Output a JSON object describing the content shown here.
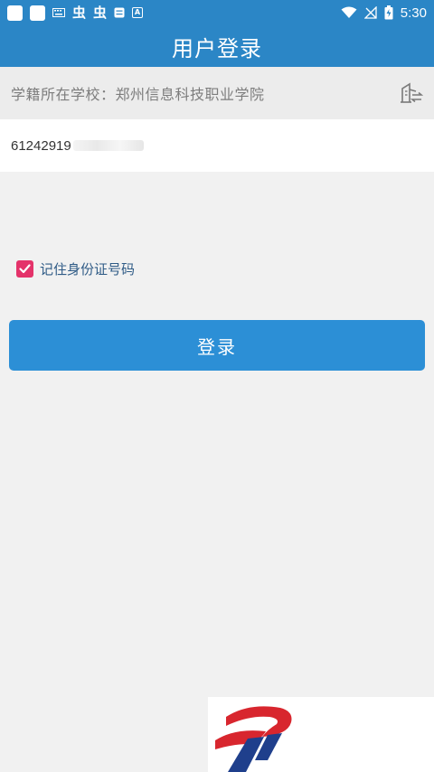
{
  "status_bar": {
    "time": "5:30",
    "left_glyph_1": "虫",
    "left_glyph_2": "虫",
    "left_box_label": "A",
    "icons": [
      "square-icon",
      "square-icon",
      "keyboard-icon",
      "bug-icon",
      "bug-icon",
      "message-icon",
      "a-box-icon",
      "wifi-icon",
      "no-sim-icon",
      "battery-charging-icon"
    ]
  },
  "header": {
    "title": "用户登录"
  },
  "school": {
    "label": "学籍所在学校：郑州信息科技职业学院",
    "icon": "building-switch-icon"
  },
  "id_field": {
    "value": "61242919"
  },
  "remember": {
    "label": "记住身份证号码",
    "checked": true
  },
  "login_button": {
    "label": "登录"
  },
  "colors": {
    "primary": "#2b86c6",
    "button": "#2c8fd6",
    "checkbox": "#e4336a",
    "background": "#f1f1f1"
  }
}
